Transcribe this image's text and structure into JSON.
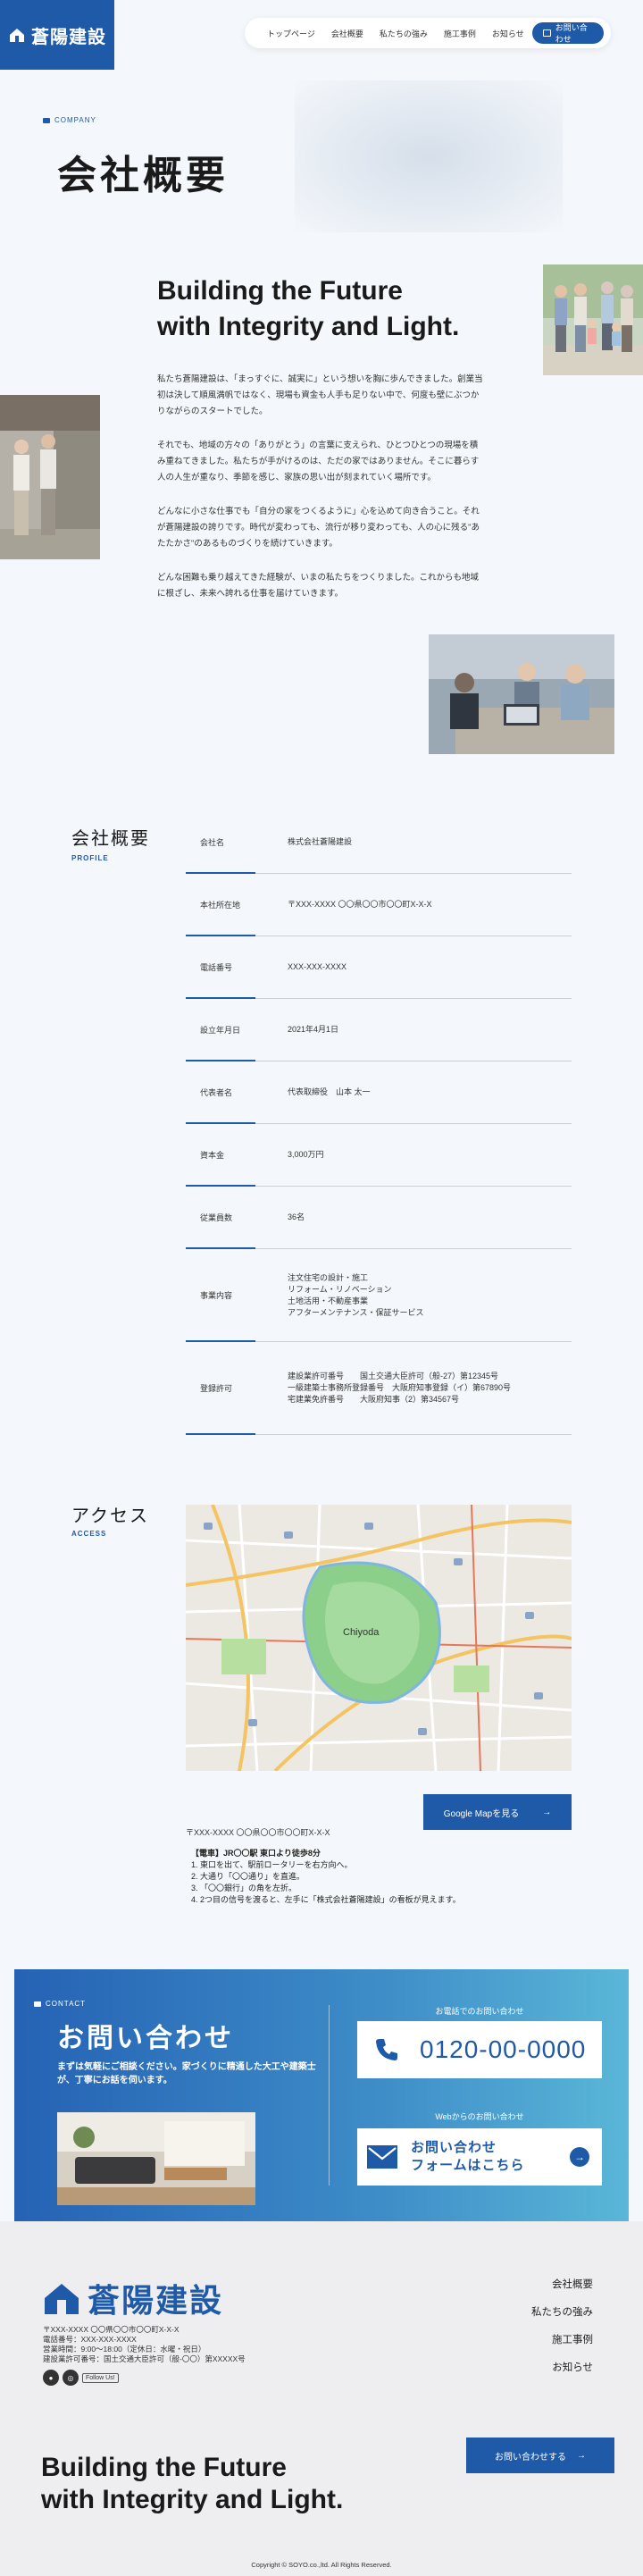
{
  "brand": {
    "name": "蒼陽建設",
    "color": "#1f5aa8"
  },
  "nav": {
    "items": [
      "トップページ",
      "会社概要",
      "私たちの強み",
      "施工事例",
      "お知らせ"
    ],
    "contact": "お問い合わせ"
  },
  "hero": {
    "label": "COMPANY",
    "title": "会社概要",
    "tagline_1": "Building the Future",
    "tagline_2": "with Integrity and Light.",
    "paragraphs": [
      "私たち蒼陽建設は、「まっすぐに、誠実に」という想いを胸に歩んできました。創業当初は決して順風満帆ではなく、現場も資金も人手も足りない中で、何度も壁にぶつかりながらのスタートでした。",
      "それでも、地域の方々の「ありがとう」の言葉に支えられ、ひとつひとつの現場を積み重ねてきました。私たちが手がけるのは、ただの家ではありません。そこに暮らす人の人生が重なり、季節を感じ、家族の思い出が刻まれていく場所です。",
      "どんなに小さな仕事でも「自分の家をつくるように」心を込めて向き合うこと。それが蒼陽建設の誇りです。時代が変わっても、流行が移り変わっても、人の心に残る\"あたたかさ\"のあるものづくりを続けていきます。",
      "どんな困難も乗り越えてきた経験が、いまの私たちをつくりました。これからも地域に根ざし、未来へ誇れる仕事を届けていきます。"
    ]
  },
  "profile": {
    "title": "会社概要",
    "sub": "PROFILE",
    "rows": [
      {
        "k": "会社名",
        "v": "株式会社蒼陽建設"
      },
      {
        "k": "本社所在地",
        "v": "〒XXX-XXXX 〇〇県〇〇市〇〇町X-X-X"
      },
      {
        "k": "電話番号",
        "v": "XXX-XXX-XXXX"
      },
      {
        "k": "設立年月日",
        "v": "2021年4月1日"
      },
      {
        "k": "代表者名",
        "v": "代表取締役　山本 太一"
      },
      {
        "k": "資本金",
        "v": "3,000万円"
      },
      {
        "k": "従業員数",
        "v": "36名"
      },
      {
        "k": "事業内容",
        "v": "注文住宅の設計・施工\nリフォーム・リノベーション\n土地活用・不動産事業\nアフターメンテナンス・保証サービス"
      },
      {
        "k": "登録許可",
        "v": "建設業許可番号　　国土交通大臣許可（般-27）第12345号\n一級建築士事務所登録番号　大阪府知事登録（イ）第67890号\n宅建業免許番号　　大阪府知事（2）第34567号"
      }
    ]
  },
  "access": {
    "title": "アクセス",
    "sub": "ACCESS",
    "map_label": "Chiyoda",
    "map_button": "Google Mapを見る",
    "address": "〒XXX-XXXX 〇〇県〇〇市〇〇町X-X-X",
    "route_title": "【電車】JR〇〇駅 東口より徒歩8分",
    "route_steps": [
      "1. 東口を出て、駅前ロータリーを右方向へ。",
      "2. 大通り「〇〇通り」を直進。",
      "3. 「〇〇銀行」の角を左折。",
      "4. 2つ目の信号を渡ると、左手に「株式会社蒼陽建設」の看板が見えます。"
    ]
  },
  "contact": {
    "label": "CONTACT",
    "title": "お問い合わせ",
    "lead": "まずは気軽にご相談ください。家づくりに精通した大工や建築士が、丁寧にお話を伺います。",
    "tel_label": "お電話でのお問い合わせ",
    "tel": "0120-00-0000",
    "web_label": "Webからのお問い合わせ",
    "web_line1": "お問い合わせ",
    "web_line2": "フォームはこちら"
  },
  "footer": {
    "name": "蒼陽建設",
    "info": [
      "〒XXX-XXXX 〇〇県〇〇市〇〇町X-X-X",
      "電話番号：XXX-XXX-XXXX",
      "営業時間：9:00〜18:00（定休日：水曜・祝日）",
      "建設業許可番号：国土交通大臣許可（般-〇〇）第XXXXX号"
    ],
    "follow": "Follow Us!",
    "nav": [
      "会社概要",
      "私たちの強み",
      "施工事例",
      "お知らせ"
    ],
    "tagline_1": "Building the Future",
    "tagline_2": "with Integrity and Light.",
    "button": "お問い合わせする",
    "copyright": "Copyright © SOYO.co.,ltd. All Rights Reserved."
  }
}
